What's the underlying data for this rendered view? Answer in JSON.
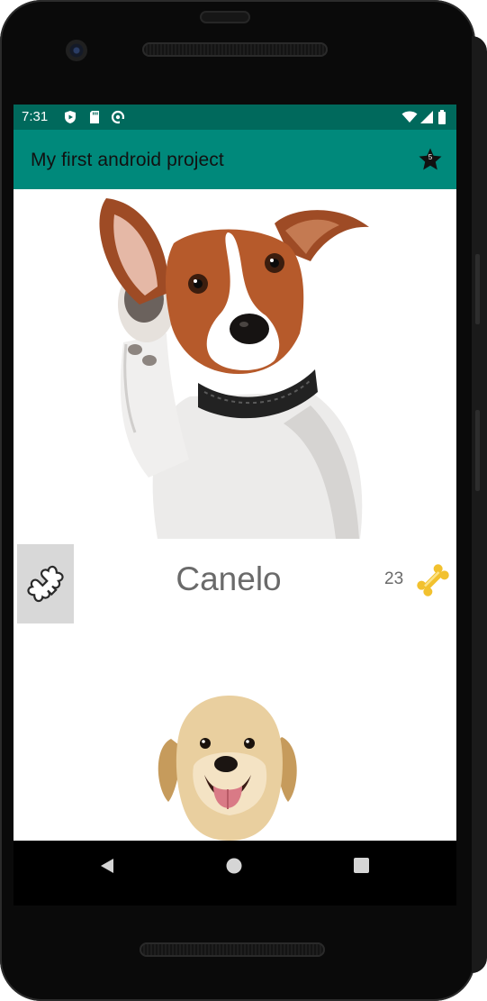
{
  "status_bar": {
    "time": "7:31",
    "left_icons": [
      "play-protect-icon",
      "sd-card-icon",
      "data-saver-icon"
    ],
    "right_icons": [
      "wifi-icon",
      "signal-icon",
      "battery-icon"
    ]
  },
  "app_bar": {
    "title": "My first android project",
    "action_icon": "star-icon",
    "action_badge": "5"
  },
  "dogs": [
    {
      "name": "Canelo",
      "bone_count": "23",
      "image": "jack-russell-terrier-photo",
      "like_icon": "bone-outline-icon",
      "count_icon": "gold-bone-icon"
    },
    {
      "image": "golden-retriever-puppy-photo"
    }
  ],
  "nav_bar": [
    "back-icon",
    "home-icon",
    "recents-icon"
  ],
  "colors": {
    "status_bar": "#00695c",
    "app_bar": "#00897b",
    "text_gray": "#6a6a6a",
    "bone_gold": "#f2c12e"
  }
}
